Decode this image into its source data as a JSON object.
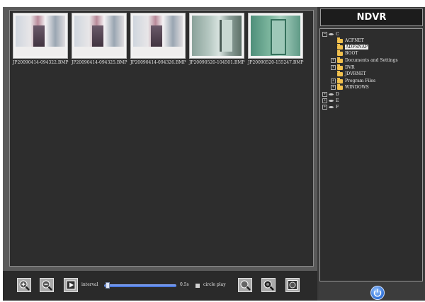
{
  "app": {
    "title": "NDVR"
  },
  "thumbnails": [
    {
      "filename": "JP20090414-094322.BMP"
    },
    {
      "filename": "JP20090414-094325.BMP"
    },
    {
      "filename": "JP20090414-094326.BMP"
    },
    {
      "filename": "JP20090520-104501.BMP"
    },
    {
      "filename": "JP20090520-155247.BMP"
    }
  ],
  "toolbar": {
    "buttons": [
      {
        "icon": "zoom-in-icon"
      },
      {
        "icon": "zoom-out-icon"
      },
      {
        "icon": "play-icon"
      },
      {
        "icon": "magnifier-icon"
      },
      {
        "icon": "magnifier-dark-icon"
      },
      {
        "icon": "magnifier-view-icon"
      }
    ],
    "interval_label": "interval",
    "interval_value": "0.5s",
    "interval_fill": 0.02,
    "circle_play_label": "circle play",
    "circle_play_checked": false
  },
  "tree": {
    "nodes": [
      {
        "label": "C",
        "type": "drive",
        "expander": "−"
      },
      {
        "label": "ACFNET",
        "type": "folder",
        "expander": ""
      },
      {
        "label": "ADFSNAP",
        "type": "folder",
        "expander": "",
        "selected": true
      },
      {
        "label": "BOOT",
        "type": "folder",
        "expander": ""
      },
      {
        "label": "Documents and Settings",
        "type": "folder",
        "expander": "+"
      },
      {
        "label": "DVR",
        "type": "folder",
        "expander": "+"
      },
      {
        "label": "JDVRNET",
        "type": "folder",
        "expander": ""
      },
      {
        "label": "Program Files",
        "type": "folder",
        "expander": "+"
      },
      {
        "label": "WINDOWS",
        "type": "folder",
        "expander": "+"
      },
      {
        "label": "D",
        "type": "drive",
        "expander": "+"
      },
      {
        "label": "E",
        "type": "drive",
        "expander": "+"
      },
      {
        "label": "F",
        "type": "drive",
        "expander": "+"
      }
    ]
  },
  "power": {
    "icon": "power-icon"
  },
  "colors": {
    "folder": "#f2c14e",
    "panel": "#2d2d2d",
    "accent": "#2c6fd8"
  }
}
